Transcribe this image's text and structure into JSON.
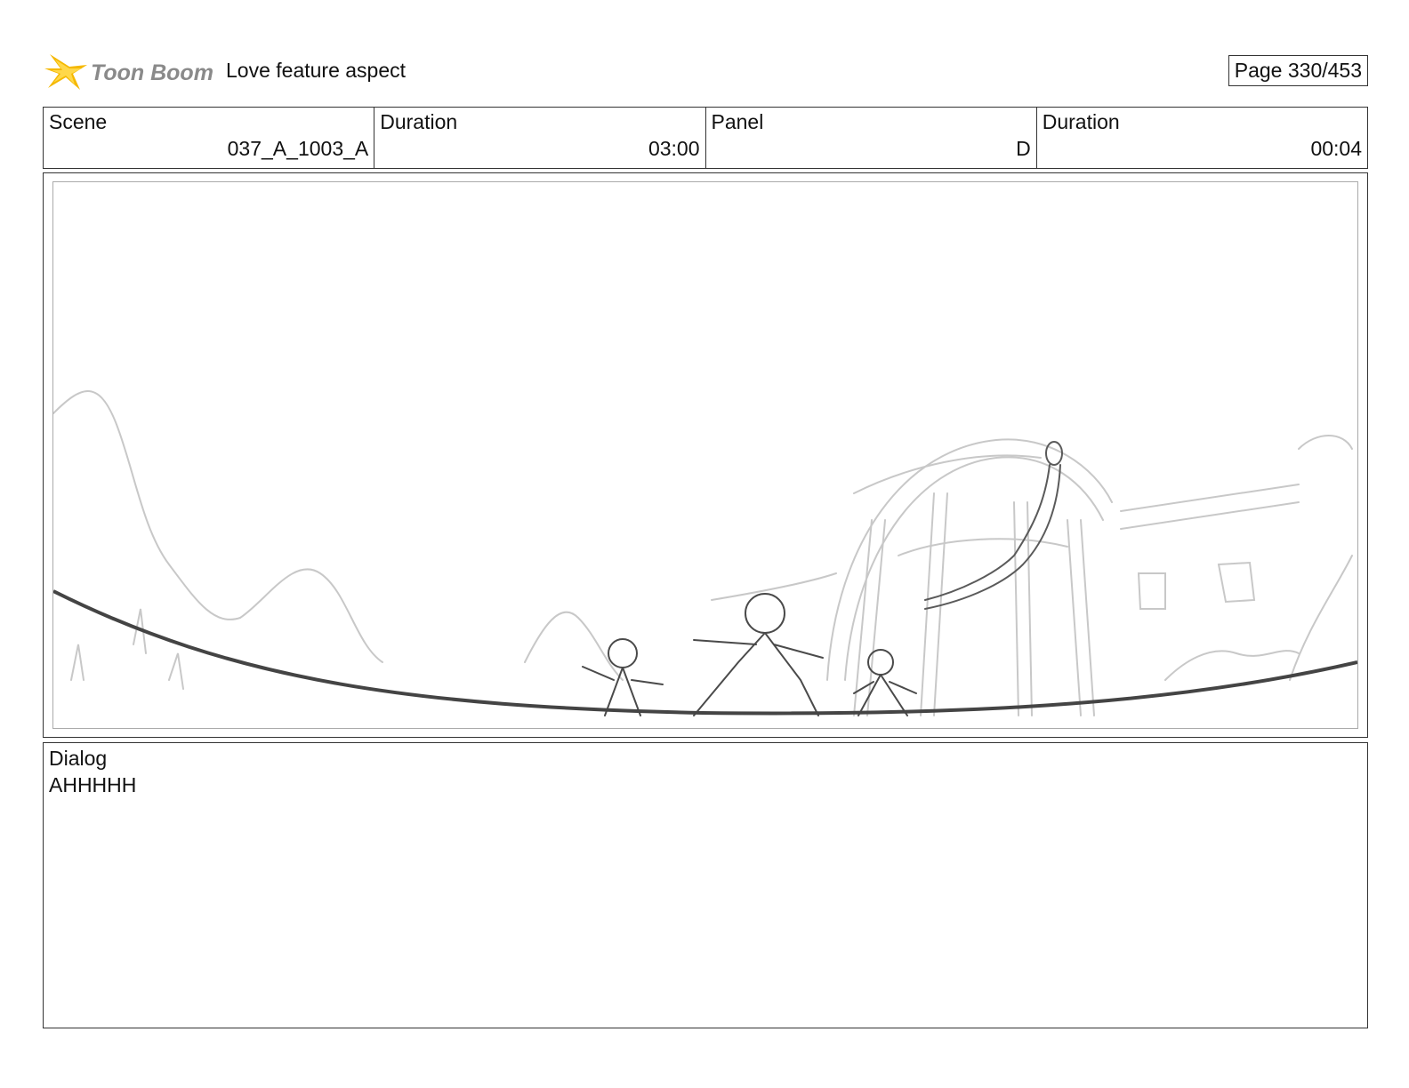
{
  "header": {
    "logo_text": "Toon Boom",
    "document_title": "Love feature aspect",
    "page_indicator": "Page 330/453"
  },
  "meta": {
    "scene_label": "Scene",
    "scene_value": "037_A_1003_A",
    "scene_duration_label": "Duration",
    "scene_duration_value": "03:00",
    "panel_label": "Panel",
    "panel_value": "D",
    "panel_duration_label": "Duration",
    "panel_duration_value": "00:04"
  },
  "dialog": {
    "label": "Dialog",
    "text": "AHHHHH"
  },
  "colors": {
    "logo_star": "#f5b800",
    "logo_text": "#8a8a8a",
    "border": "#333333",
    "sketch_light": "#c8c8c8",
    "sketch_dark": "#4a4a4a"
  },
  "icons": {
    "logo": "toon-boom-star-icon"
  }
}
